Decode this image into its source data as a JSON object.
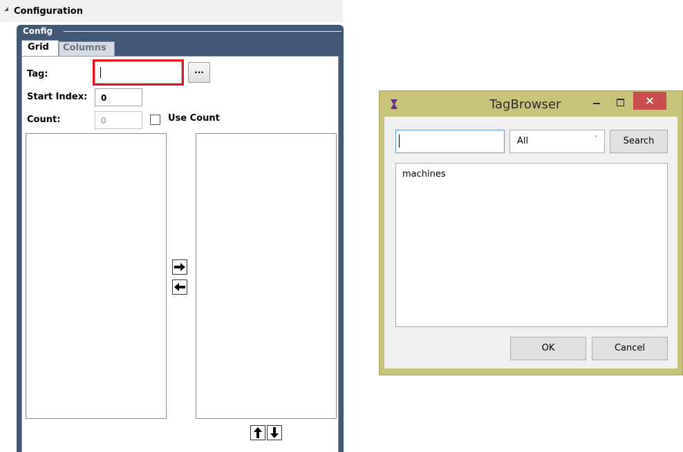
{
  "config_panel": {
    "header_title": "Configuration",
    "legend": "Config",
    "tabs": [
      {
        "label": "Grid",
        "active": true
      },
      {
        "label": "Columns",
        "active": false
      }
    ],
    "tag_label": "Tag:",
    "tag_value": "",
    "browse_label": "...",
    "start_index_label": "Start Index:",
    "start_index_value": "0",
    "count_label": "Count:",
    "count_value": "0",
    "use_count_label": "Use Count",
    "use_count_checked": false
  },
  "tag_browser": {
    "title": "TagBrowser",
    "search_value": "",
    "filter_selected": "All",
    "search_button": "Search",
    "results": [
      "machines"
    ],
    "ok_button": "OK",
    "cancel_button": "Cancel",
    "close_glyph": "×"
  },
  "colors": {
    "panel_frame": "#435875",
    "highlight_border": "#e0161e",
    "dialog_frame": "#c8c37b",
    "close_button": "#c94f4f"
  }
}
